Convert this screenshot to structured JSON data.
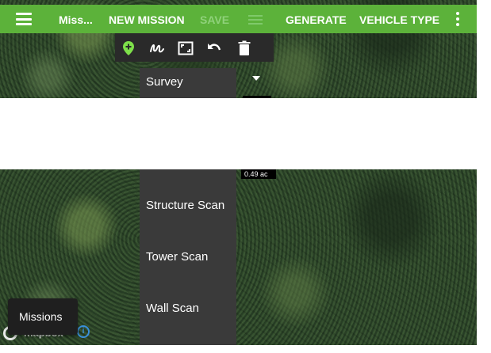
{
  "appbar": {
    "title": "Miss...",
    "new_mission": "NEW MISSION",
    "save": "SAVE",
    "generate": "GENERATE",
    "vehicle_type": "VEHICLE TYPE",
    "bg_color": "#5cb23a"
  },
  "toolbar": {
    "icons": [
      "add-waypoint-icon",
      "freehand-draw-icon",
      "area-select-icon",
      "undo-icon",
      "trash-icon"
    ],
    "accent": "#7ee04a"
  },
  "dropdown": {
    "selected": "Survey",
    "options": [
      "Structure Scan",
      "Tower Scan",
      "Wall Scan"
    ]
  },
  "map": {
    "area_label": "0.49 ac",
    "attribution": "mapbox"
  },
  "missions_button": {
    "label": "Missions"
  }
}
